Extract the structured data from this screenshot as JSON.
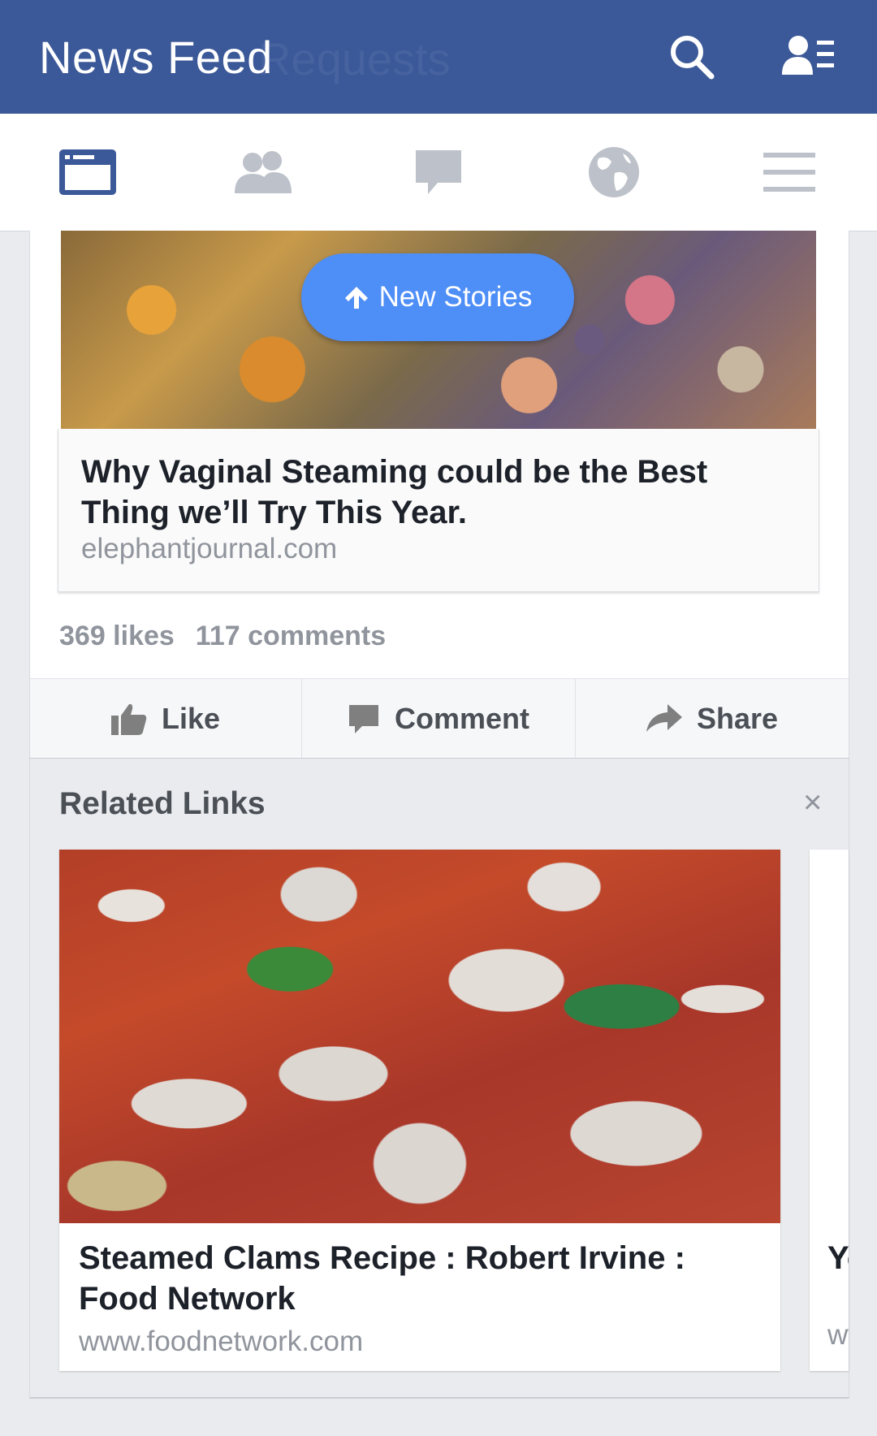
{
  "header": {
    "title": "News Feed",
    "ghost_text": "Requests"
  },
  "tabs": [
    {
      "name": "news-feed",
      "icon": "news-feed-icon",
      "active": true
    },
    {
      "name": "friend-requests",
      "icon": "friends-icon",
      "active": false
    },
    {
      "name": "messages",
      "icon": "chat-bubble-icon",
      "active": false
    },
    {
      "name": "notifications",
      "icon": "globe-icon",
      "active": false
    },
    {
      "name": "more",
      "icon": "hamburger-menu-icon",
      "active": false
    }
  ],
  "new_stories": {
    "label": "New Stories"
  },
  "story": {
    "link_title": "Why Vaginal Steaming could be the Best Thing we’ll Try This Year.",
    "link_domain": "elephantjournal.com",
    "likes": "369 likes",
    "comments": "117 comments",
    "actions": {
      "like": "Like",
      "comment": "Comment",
      "share": "Share"
    }
  },
  "related": {
    "title": "Related Links",
    "close": "×",
    "cards": [
      {
        "title": "Steamed Clams Recipe : Robert Irvine : Food Network",
        "domain": "www.foodnetwork.com"
      },
      {
        "title": "Yor",
        "domain": "www"
      }
    ]
  },
  "colors": {
    "brand": "#3b5998",
    "pill": "#4e8ef7",
    "muted": "#90949c"
  }
}
